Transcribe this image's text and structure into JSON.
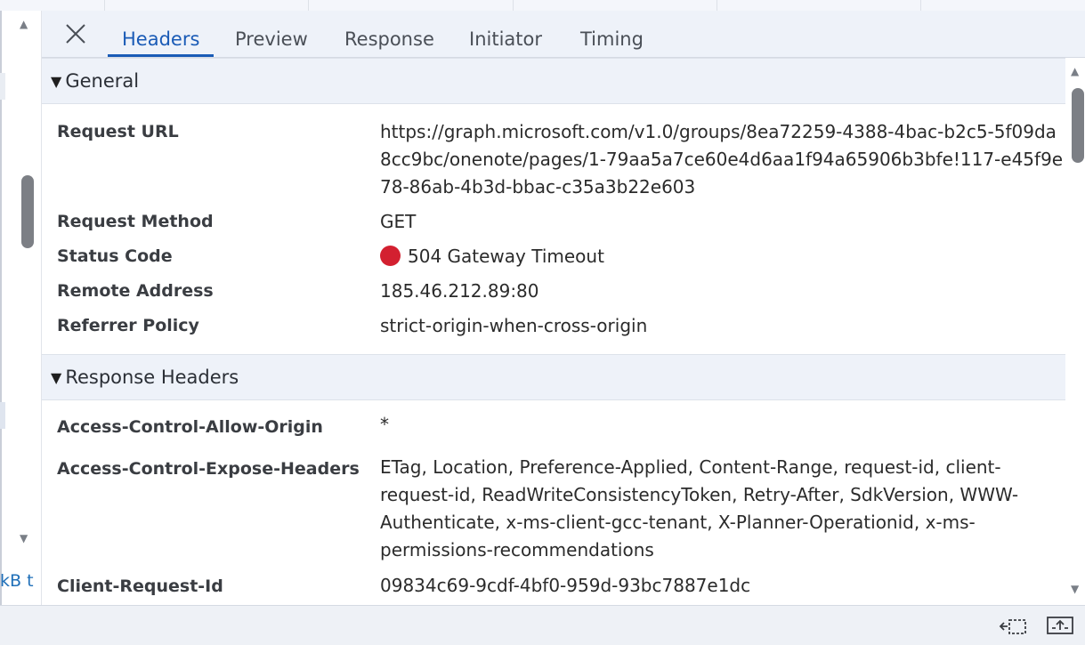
{
  "left_pane": {
    "size_fragment": "kB t"
  },
  "tabs": [
    {
      "label": "Headers",
      "active": true
    },
    {
      "label": "Preview",
      "active": false
    },
    {
      "label": "Response",
      "active": false
    },
    {
      "label": "Initiator",
      "active": false
    },
    {
      "label": "Timing",
      "active": false
    }
  ],
  "general": {
    "title": "General",
    "request_url_label": "Request URL",
    "request_url": "https://graph.microsoft.com/v1.0/groups/8ea72259-4388-4bac-b2c5-5f09da8cc9bc/onenote/pages/1-79aa5a7ce60e4d6aa1f94a65906b3bfe!117-e45f9e78-86ab-4b3d-bbac-c35a3b22e603",
    "request_method_label": "Request Method",
    "request_method": "GET",
    "status_code_label": "Status Code",
    "status_code": "504 Gateway Timeout",
    "status_color": "#d32030",
    "remote_address_label": "Remote Address",
    "remote_address": "185.46.212.89:80",
    "referrer_policy_label": "Referrer Policy",
    "referrer_policy": "strict-origin-when-cross-origin"
  },
  "response_headers": {
    "title": "Response Headers",
    "acao_label": "Access-Control-Allow-Origin",
    "acao": "*",
    "aceh_label": "Access-Control-Expose-Headers",
    "aceh": "ETag, Location, Preference-Applied, Content-Range, request-id, client-request-id, ReadWriteConsistencyToken, Retry-After, SdkVersion, WWW-Authenticate, x-ms-client-gcc-tenant, X-Planner-Operationid, x-ms-permissions-recommendations",
    "client_request_id_label": "Client-Request-Id",
    "client_request_id": "09834c69-9cdf-4bf0-959d-93bc7887e1dc"
  },
  "colors": {
    "accent": "#1a5bb6",
    "panel_bg": "#eef2f9"
  },
  "icons": {
    "close": "close-icon",
    "dock": "dock-side-icon",
    "undock": "undock-icon"
  }
}
